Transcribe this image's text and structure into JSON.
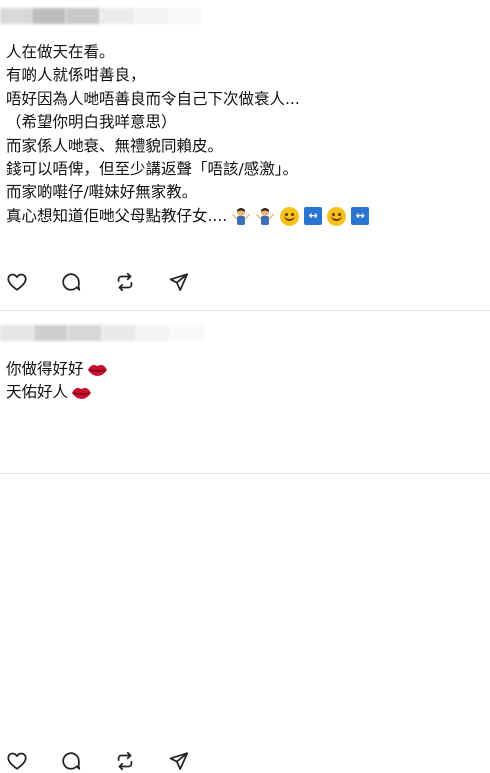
{
  "posts": [
    {
      "lines": [
        "人在做天在看。",
        "有啲人就係咁善良，",
        "唔好因為人哋唔善良而令自己下次做衰人...",
        "（希望你明白我咩意思）",
        "而家係人哋衰、無禮貌同賴皮。",
        "錢可以唔俾，但至少講返聲「唔該/感激」。",
        "而家啲嚡仔/嚡妹好無家教。",
        "真心想知道佢哋父母點教仔女...."
      ],
      "trailing_emojis": [
        "person-shrugging",
        "person-shrugging",
        "slightly-smiling-face",
        "left-right-arrow",
        "slightly-smiling-face",
        "left-right-arrow"
      ],
      "actions": [
        "like-icon",
        "comment-icon",
        "repost-icon",
        "share-icon"
      ]
    },
    {
      "lines": [
        "你做得好好",
        "天佑好人"
      ],
      "trailing_emojis": [
        "lips",
        "lips"
      ],
      "actions": [
        "like-icon",
        "comment-icon",
        "repost-icon",
        "share-icon"
      ]
    }
  ],
  "colors": {
    "text": "#111111",
    "icon": "#222222",
    "divider": "#e2e2e2",
    "emoji_blue": "#2a75d2",
    "emoji_yellow": "#f5c21b",
    "lips_red": "#c8102e"
  }
}
